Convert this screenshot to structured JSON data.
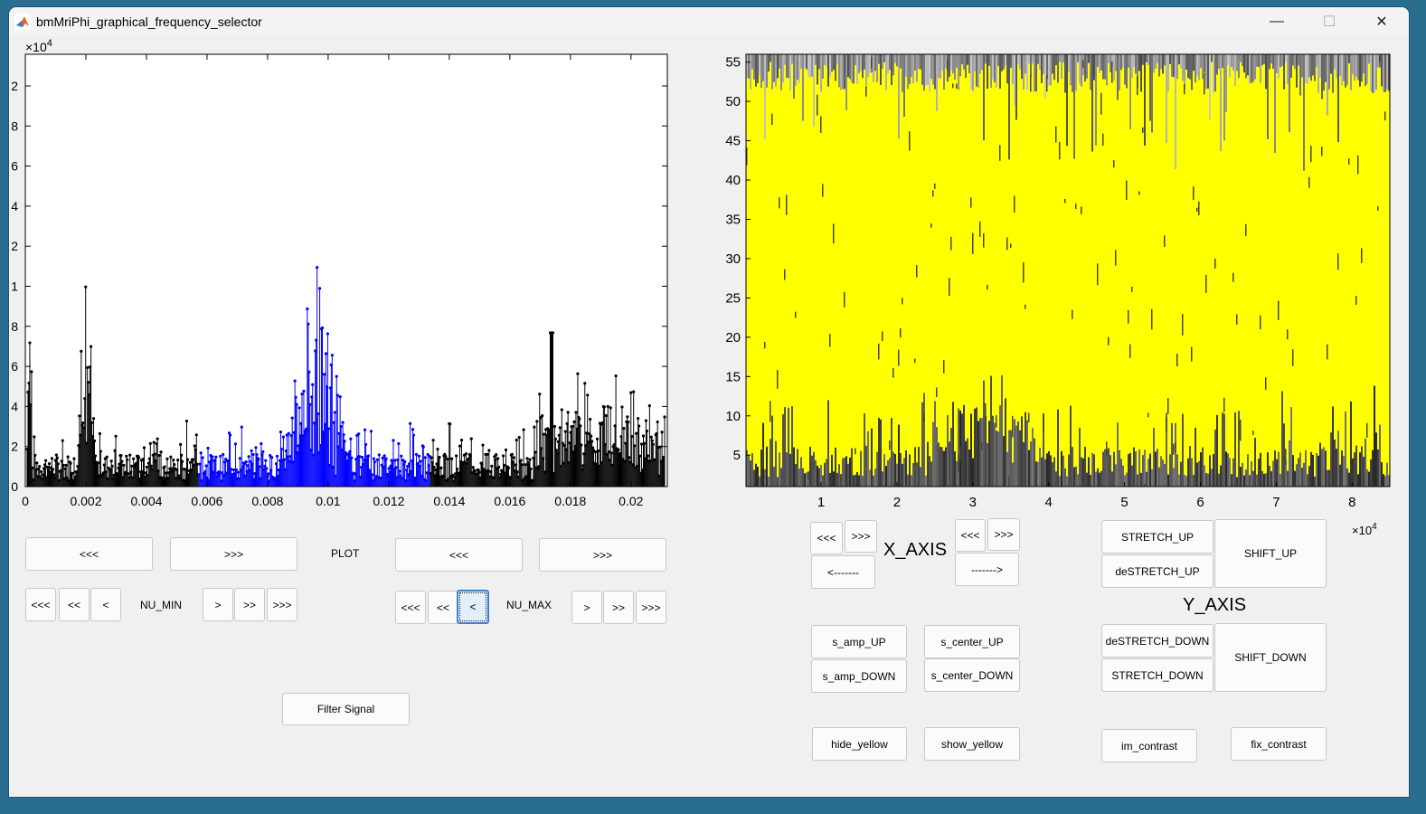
{
  "window": {
    "title": "bmMriPhi_graphical_frequency_selector",
    "minimize_glyph": "—",
    "maximize_glyph": "☐",
    "close_glyph": "✕"
  },
  "left_plot": {
    "exponent_label": "×10",
    "exponent_power": "4",
    "x_ticks": [
      "0",
      "0.002",
      "0.004",
      "0.006",
      "0.008",
      "0.01",
      "0.012",
      "0.014",
      "0.016",
      "0.018",
      "0.02"
    ],
    "y_ticks": [
      "0",
      "2",
      "4",
      "6",
      "8",
      "1",
      "2",
      "4",
      "6",
      "8",
      "2"
    ],
    "colors": {
      "unselected": "#000000",
      "selected": "#0000ff"
    }
  },
  "right_plot": {
    "y_ticks": [
      "5",
      "10",
      "15",
      "20",
      "25",
      "30",
      "35",
      "40",
      "45",
      "50",
      "55"
    ],
    "x_ticks": [
      "1",
      "2",
      "3",
      "4",
      "5",
      "6",
      "7",
      "8"
    ],
    "exponent_label": "×10",
    "exponent_power": "4",
    "colors": {
      "overlay": "#ffff00",
      "image_dark": "#3a3a3a"
    }
  },
  "left_controls": {
    "plot_prev": "<<<",
    "plot_next": ">>>",
    "plot_label": "PLOT",
    "plot2_prev": "<<<",
    "plot2_next": ">>>",
    "numin_label": "NU_MIN",
    "numin_buttons": [
      "<<<",
      "<<",
      "<",
      ">",
      ">>",
      ">>>"
    ],
    "numax_label": "NU_MAX",
    "numax_buttons": [
      "<<<",
      "<<",
      "<",
      ">",
      ">>",
      ">>>"
    ],
    "filter": "Filter Signal"
  },
  "right_controls": {
    "xaxis_label": "X_AXIS",
    "x_left_fast": "<<<",
    "x_left_faster": ">>>",
    "x_right_fast": "<<<",
    "x_right_faster": ">>>",
    "x_back": "<-------",
    "x_forward": "------->",
    "yaxis_label": "Y_AXIS",
    "stretch_up": "STRETCH_UP",
    "destretch_up": "deSTRETCH_UP",
    "shift_up": "SHIFT_UP",
    "destretch_down": "deSTRETCH_DOWN",
    "stretch_down": "STRETCH_DOWN",
    "shift_down": "SHIFT_DOWN",
    "s_amp_up": "s_amp_UP",
    "s_amp_down": "s_amp_DOWN",
    "s_center_up": "s_center_UP",
    "s_center_down": "s_center_DOWN",
    "hide_yellow": "hide_yellow",
    "show_yellow": "show_yellow",
    "im_contrast": "im_contrast",
    "fix_contrast": "fix_contrast"
  }
}
